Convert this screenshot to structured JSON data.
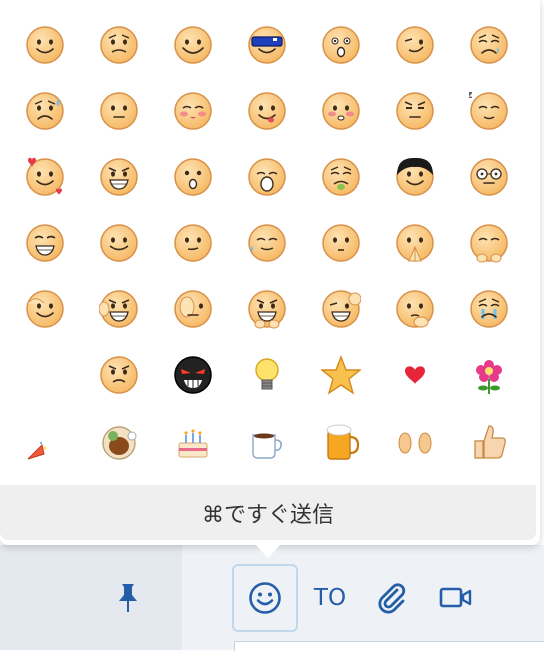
{
  "emoji_picker": {
    "send_hint": "⌘ですぐ送信",
    "rows": [
      [
        "smile",
        "grimace",
        "happy",
        "sunglasses",
        "surprised",
        "wink",
        "cry"
      ],
      [
        "sweat",
        "blank",
        "blush",
        "tongue",
        "flushed",
        "annoyed",
        "sleepy"
      ],
      [
        "love",
        "grin",
        "shocked",
        "yawn",
        "sick",
        "dark-hair",
        "glasses"
      ],
      [
        "big-grin",
        "content",
        "puzzled",
        "nervous",
        "shy",
        "pray",
        "bow"
      ],
      [
        "salute",
        "clap",
        "listen",
        "uncertain",
        "wink-peace",
        "think",
        "weep"
      ],
      [
        "empty",
        "angry",
        "devil",
        "lightbulb",
        "star",
        "heart",
        "flower"
      ],
      [
        "party-popper",
        "chicken",
        "cake",
        "coffee",
        "beer",
        "clap-hands",
        "thumbs-up"
      ]
    ]
  },
  "toolbar": {
    "to_label": "TO",
    "tools": [
      "pin-icon",
      "smiley-icon",
      "to-button",
      "paperclip-icon",
      "video-icon"
    ]
  },
  "colors": {
    "face": "#f6b761",
    "face_highlight": "#fde3b3",
    "outline": "#d8914a",
    "accent": "#245da8",
    "hint_bg": "#efefef"
  }
}
